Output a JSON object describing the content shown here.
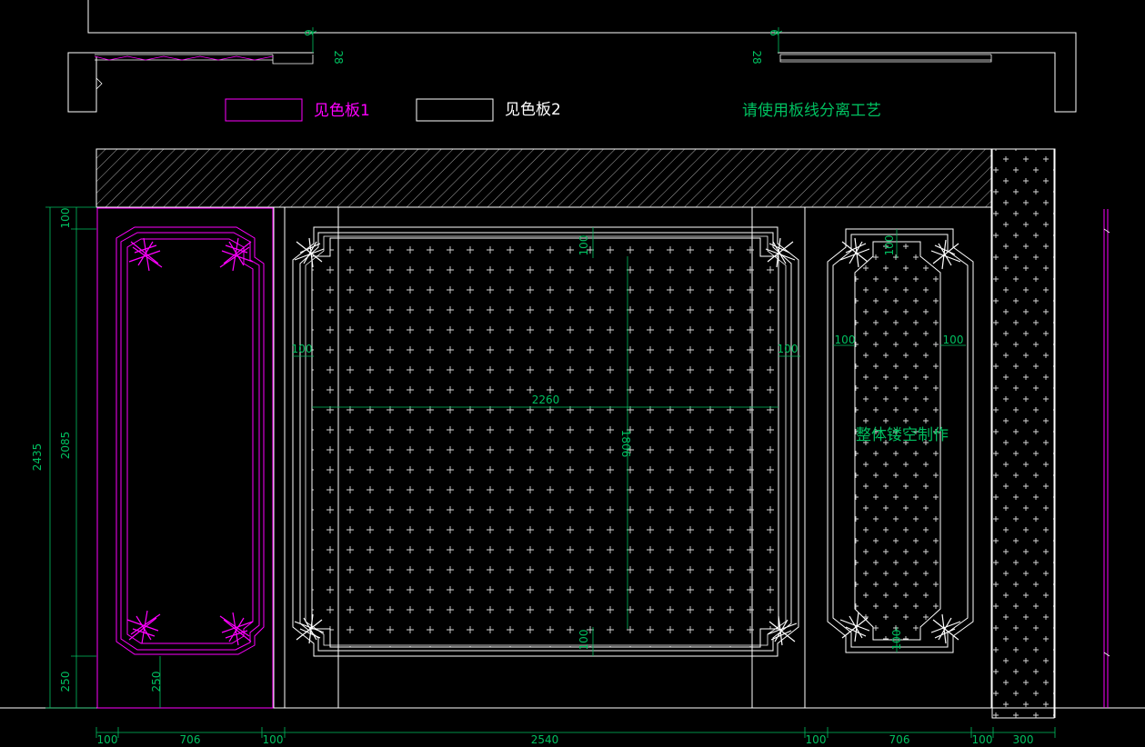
{
  "legend": {
    "panel1": "见色板1",
    "panel2": "见色板2"
  },
  "notes": {
    "separation": "请使用板线分离工艺",
    "hollow": "整体镂空制作"
  },
  "section_dims": {
    "gap_left": "9",
    "gap_right": "9",
    "depth_left": "28",
    "depth_right": "28"
  },
  "dims": {
    "total_height": "2435",
    "top_offset": "100",
    "panel_height": "2085",
    "base_height": "250",
    "inner_base": "250",
    "main_width": "2260",
    "main_height": "1806",
    "main_top": "100",
    "main_bottom": "100",
    "main_left": "100",
    "main_right": "100",
    "right_top": "100",
    "right_bottom": "100",
    "right_left": "100",
    "right_right": "100"
  },
  "bottom_dims": [
    "100",
    "706",
    "100",
    "2540",
    "100",
    "706",
    "100",
    "300"
  ],
  "colors": {
    "magenta": "#ff00ff",
    "green": "#00c060",
    "white": "#ffffff",
    "background": "#000000"
  }
}
